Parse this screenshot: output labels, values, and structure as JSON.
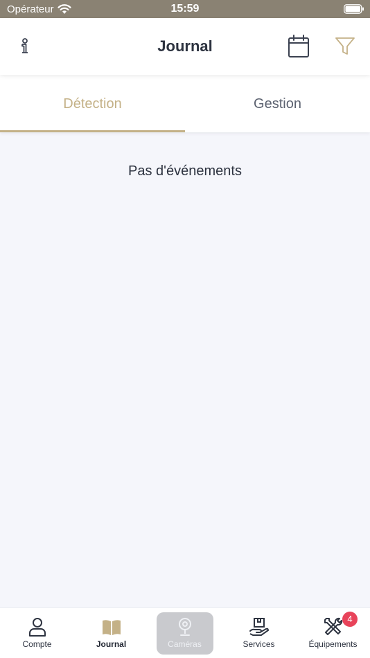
{
  "status_bar": {
    "carrier": "Opérateur",
    "time": "15:59"
  },
  "header": {
    "title": "Journal",
    "icons": [
      "info-icon",
      "calendar-icon",
      "filter-icon"
    ]
  },
  "tabs": [
    {
      "label": "Détection",
      "active": true
    },
    {
      "label": "Gestion",
      "active": false
    }
  ],
  "main": {
    "empty_message": "Pas d'événements"
  },
  "tab_bar": {
    "items": [
      {
        "label": "Compte",
        "icon": "user-icon"
      },
      {
        "label": "Journal",
        "icon": "book-icon"
      },
      {
        "label": "Caméras",
        "icon": "camera-icon"
      },
      {
        "label": "Services",
        "icon": "services-icon"
      },
      {
        "label": "Équipements",
        "icon": "tools-icon"
      }
    ],
    "equipment_badge": "4"
  },
  "colors": {
    "accent": "#c4b187",
    "status_bar": "#8a8273",
    "text_dark": "#2d3340",
    "badge": "#e8435a",
    "background": "#f5f6fb"
  }
}
